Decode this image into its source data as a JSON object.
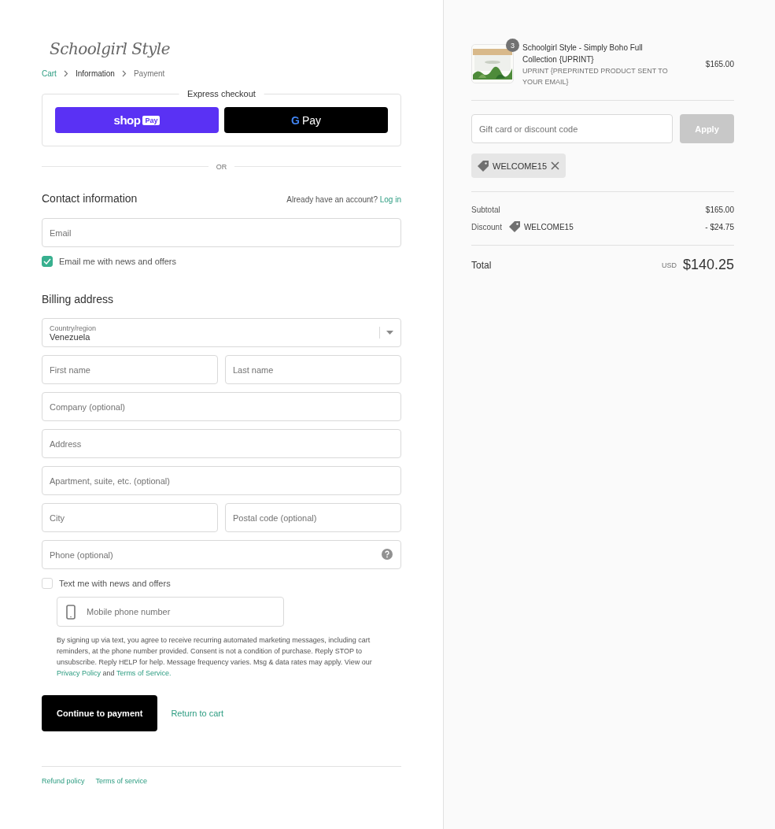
{
  "logo": {
    "text": "Schoolgirl Style"
  },
  "breadcrumbs": [
    {
      "label": "Cart",
      "kind": "link",
      "selected": false
    },
    {
      "label": "Information",
      "kind": "current",
      "selected": true
    },
    {
      "label": "Payment",
      "kind": "upcoming",
      "selected": false
    }
  ],
  "express_checkout": {
    "title": "Express checkout",
    "shop_pay": {
      "brand": "shop",
      "badge": "Pay"
    },
    "google_pay": {
      "letter": "G",
      "label": "Pay"
    }
  },
  "divider": "OR",
  "contact": {
    "title": "Contact information",
    "account_prompt": "Already have an account?",
    "login_link": "Log in",
    "email": {
      "placeholder": "Email"
    },
    "news_checkbox": {
      "label": "Email me with news and offers",
      "checked": true
    }
  },
  "billing": {
    "title": "Billing address",
    "rows": [
      [
        {
          "kind": "select",
          "label": "Country/region",
          "value": "Venezuela"
        }
      ],
      [
        {
          "kind": "text",
          "placeholder": "First name"
        },
        {
          "kind": "text",
          "placeholder": "Last name"
        }
      ],
      [
        {
          "kind": "text",
          "placeholder": "Company (optional)"
        }
      ],
      [
        {
          "kind": "text",
          "placeholder": "Address"
        }
      ],
      [
        {
          "kind": "text",
          "placeholder": "Apartment, suite, etc. (optional)"
        }
      ],
      [
        {
          "kind": "text",
          "placeholder": "City"
        },
        {
          "kind": "text",
          "placeholder": "Postal code (optional)"
        }
      ],
      [
        {
          "kind": "help",
          "placeholder": "Phone (optional)"
        }
      ]
    ]
  },
  "sms": {
    "checkbox": {
      "label": "Text me with news and offers",
      "checked": false
    },
    "mobile": {
      "placeholder": "Mobile phone number"
    },
    "consent": "By signing up via text, you agree to receive recurring automated marketing messages, including cart reminders, at the phone number provided. Consent is not a condition of purchase. Reply STOP to unsubscribe. Reply HELP for help. Message frequency varies. Msg & data rates may apply. View our",
    "privacy_link": "Privacy Policy",
    "and": "and",
    "terms_link": "Terms of Service."
  },
  "actions": {
    "continue": "Continue to payment",
    "return": "Return to cart"
  },
  "footer_links": [
    "Refund policy",
    "Terms of service"
  ],
  "summary": {
    "product": {
      "quantity": "3",
      "title": "Schoolgirl Style - Simply Boho Full Collection {UPRINT}",
      "variant": "UPRINT {PREPRINTED PRODUCT SENT TO YOUR EMAIL}",
      "price": "$165.00"
    },
    "discount_field": {
      "placeholder": "Gift card or discount code"
    },
    "apply": {
      "label": "Apply",
      "disabled": true
    },
    "applied_code": "WELCOME15",
    "lines": [
      {
        "kind": "plain",
        "label": "Subtotal",
        "value": "$165.00"
      },
      {
        "kind": "discount",
        "label": "Discount",
        "code": "WELCOME15",
        "value": "- $24.75"
      }
    ],
    "total": {
      "label": "Total",
      "currency": "USD",
      "amount": "$140.25"
    }
  }
}
